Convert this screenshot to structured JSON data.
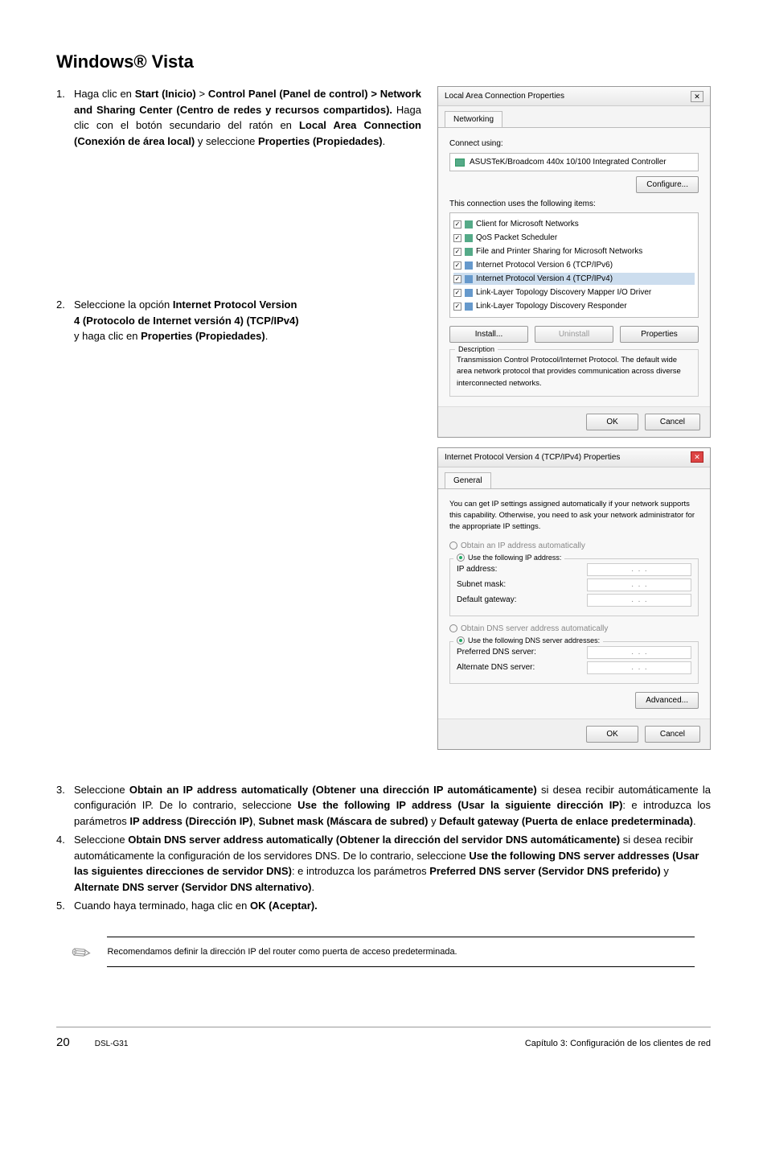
{
  "heading": "Windows® Vista",
  "steps_top": [
    {
      "num": "1.",
      "parts": [
        {
          "t": "Haga clic en "
        },
        {
          "t": "Start (Inicio)",
          "b": true
        },
        {
          "t": " > "
        },
        {
          "t": "Control Panel (Panel de control) > Network and Sharing Center (Centro de redes y recursos compartidos).",
          "b": true
        },
        {
          "t": " Haga clic con el botón secundario del ratón en "
        },
        {
          "t": "Local Area Connection (Conexión de área local)",
          "b": true
        },
        {
          "t": " y seleccione "
        },
        {
          "t": "Properties (Propiedades)",
          "b": true
        },
        {
          "t": "."
        }
      ]
    },
    {
      "num": "2.",
      "parts": [
        {
          "t": "Seleccione la opción "
        },
        {
          "t": "Internet Protocol Version 4 (Protocolo de Internet versión 4) (TCP/IPv4)",
          "b": true
        },
        {
          "t": " y haga clic en "
        },
        {
          "t": "Properties (Propiedades)",
          "b": true
        },
        {
          "t": "."
        }
      ]
    }
  ],
  "steps_full": [
    {
      "num": "3.",
      "parts": [
        {
          "t": "Seleccione "
        },
        {
          "t": "Obtain an IP address automatically (Obtener una dirección IP automáticamente)",
          "b": true
        },
        {
          "t": " si desea recibir automáticamente la configuración IP. De lo contrario, seleccione "
        },
        {
          "t": "Use the following IP address (Usar la siguiente dirección IP)",
          "b": true
        },
        {
          "t": ": e introduzca los parámetros "
        },
        {
          "t": "IP address (Dirección IP)",
          "b": true
        },
        {
          "t": ", "
        },
        {
          "t": "Subnet mask (Máscara de subred)",
          "b": true
        },
        {
          "t": " y "
        },
        {
          "t": "Default gateway (Puerta de enlace predeterminada)",
          "b": true
        },
        {
          "t": "."
        }
      ]
    },
    {
      "num": "4.",
      "parts": [
        {
          "t": "Seleccione "
        },
        {
          "t": "Obtain DNS server address automatically (Obtener la dirección del servidor DNS automáticamente)",
          "b": true
        },
        {
          "t": " si desea recibir automáticamente la configuración de los servidores DNS. De lo contrario, seleccione "
        },
        {
          "t": "Use the following DNS server addresses (Usar las siguientes direcciones de servidor DNS)",
          "b": true
        },
        {
          "t": ": e introduzca los parámetros "
        },
        {
          "t": "Preferred DNS server (Servidor DNS preferido)",
          "b": true
        },
        {
          "t": " y "
        },
        {
          "t": "Alternate DNS server (Servidor DNS alternativo)",
          "b": true
        },
        {
          "t": "."
        }
      ]
    },
    {
      "num": "5.",
      "parts": [
        {
          "t": "Cuando haya terminado, haga clic en "
        },
        {
          "t": "OK (Aceptar).",
          "b": true
        }
      ]
    }
  ],
  "dialog1": {
    "title": "Local Area Connection Properties",
    "tab": "Networking",
    "connect_label": "Connect using:",
    "adapter": "ASUSTeK/Broadcom 440x 10/100 Integrated Controller",
    "configure": "Configure...",
    "items_label": "This connection uses the following items:",
    "items": [
      "Client for Microsoft Networks",
      "QoS Packet Scheduler",
      "File and Printer Sharing for Microsoft Networks",
      "Internet Protocol Version 6 (TCP/IPv6)",
      "Internet Protocol Version 4 (TCP/IPv4)",
      "Link-Layer Topology Discovery Mapper I/O Driver",
      "Link-Layer Topology Discovery Responder"
    ],
    "install": "Install...",
    "uninstall": "Uninstall",
    "properties": "Properties",
    "desc_title": "Description",
    "desc": "Transmission Control Protocol/Internet Protocol. The default wide area network protocol that provides communication across diverse interconnected networks.",
    "ok": "OK",
    "cancel": "Cancel"
  },
  "dialog2": {
    "title": "Internet Protocol Version 4 (TCP/IPv4) Properties",
    "tab": "General",
    "intro": "You can get IP settings assigned automatically if your network supports this capability. Otherwise, you need to ask your network administrator for the appropriate IP settings.",
    "radio_auto_ip": "Obtain an IP address automatically",
    "radio_manual_ip": "Use the following IP address:",
    "ip_address": "IP address:",
    "subnet": "Subnet mask:",
    "gateway": "Default gateway:",
    "radio_auto_dns": "Obtain DNS server address automatically",
    "radio_manual_dns": "Use the following DNS server addresses:",
    "pref_dns": "Preferred DNS server:",
    "alt_dns": "Alternate DNS server:",
    "advanced": "Advanced...",
    "ok": "OK",
    "cancel": "Cancel"
  },
  "note": "Recomendamos definir la dirección IP del router como puerta de acceso predeterminada.",
  "footer": {
    "page": "20",
    "model": "DSL-G31",
    "chapter": "Capítulo 3: Configuración de los clientes de red"
  }
}
